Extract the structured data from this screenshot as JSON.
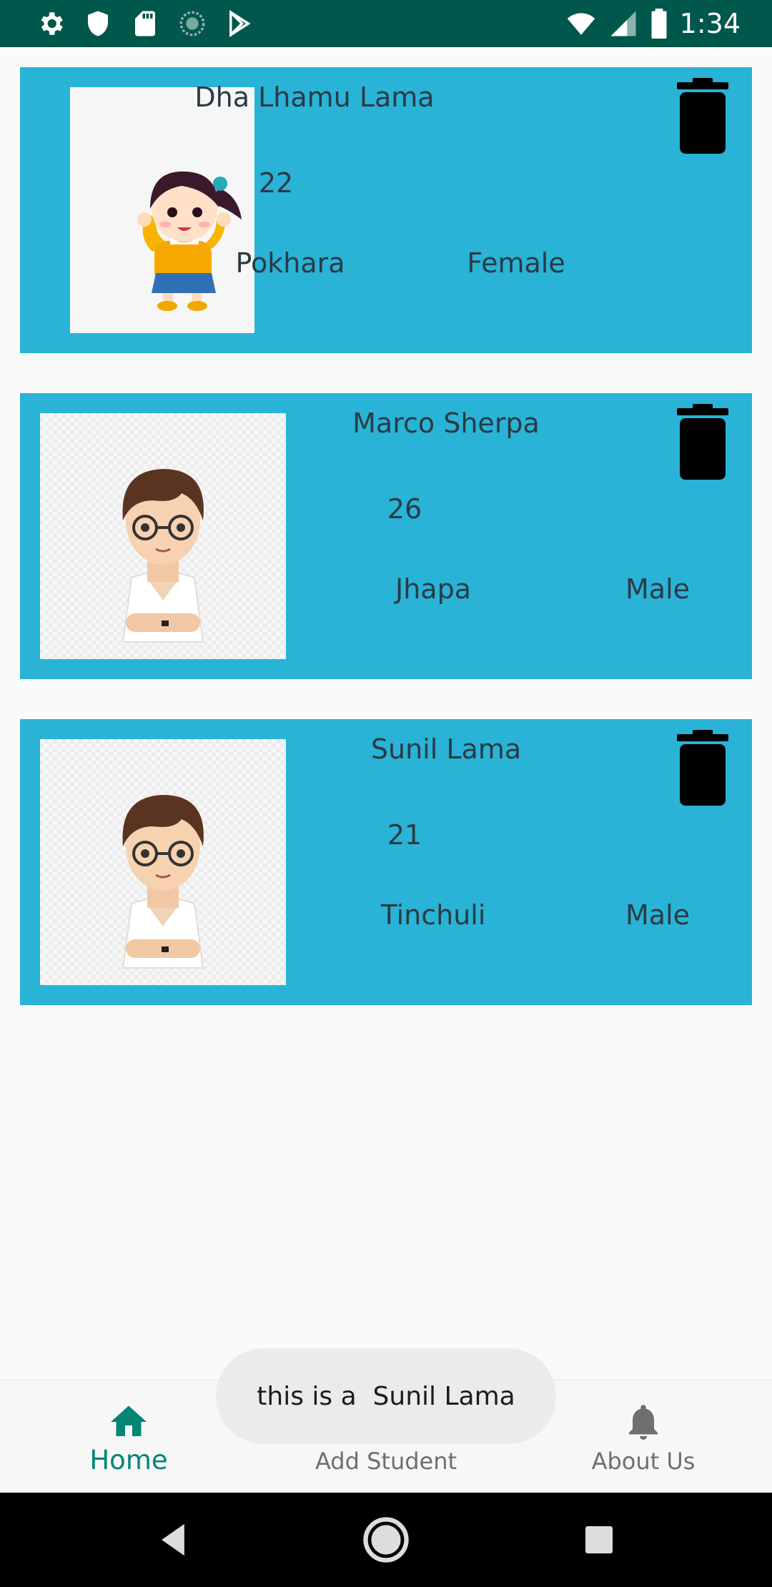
{
  "status_bar": {
    "time": "1:34",
    "left_icons": [
      "gear-icon",
      "shield-icon",
      "sd-card-icon",
      "sync-circle-icon",
      "play-store-icon"
    ],
    "right_icons": [
      "wifi-icon",
      "cell-signal-icon",
      "battery-icon"
    ]
  },
  "students": [
    {
      "name": "Dha Lhamu Lama",
      "age": "22",
      "city": "Pokhara",
      "gender": "Female",
      "avatar": "girl-avatar"
    },
    {
      "name": "Marco Sherpa",
      "age": "26",
      "city": "Jhapa",
      "gender": "Male",
      "avatar": "boy-avatar"
    },
    {
      "name": "Sunil Lama",
      "age": "21",
      "city": "Tinchuli",
      "gender": "Male",
      "avatar": "boy-avatar"
    }
  ],
  "bottom_nav": {
    "items": [
      {
        "label": "Home",
        "icon": "home-icon",
        "active": true
      },
      {
        "label": "Add Student",
        "icon": "add-person-icon",
        "active": false
      },
      {
        "label": "About Us",
        "icon": "bell-icon",
        "active": false
      }
    ]
  },
  "toast": {
    "text": "this is a  Sunil Lama"
  },
  "colors": {
    "status_bar": "#00574b",
    "card": "#29b3d6",
    "accent": "#008577",
    "text": "#2b3a45"
  }
}
